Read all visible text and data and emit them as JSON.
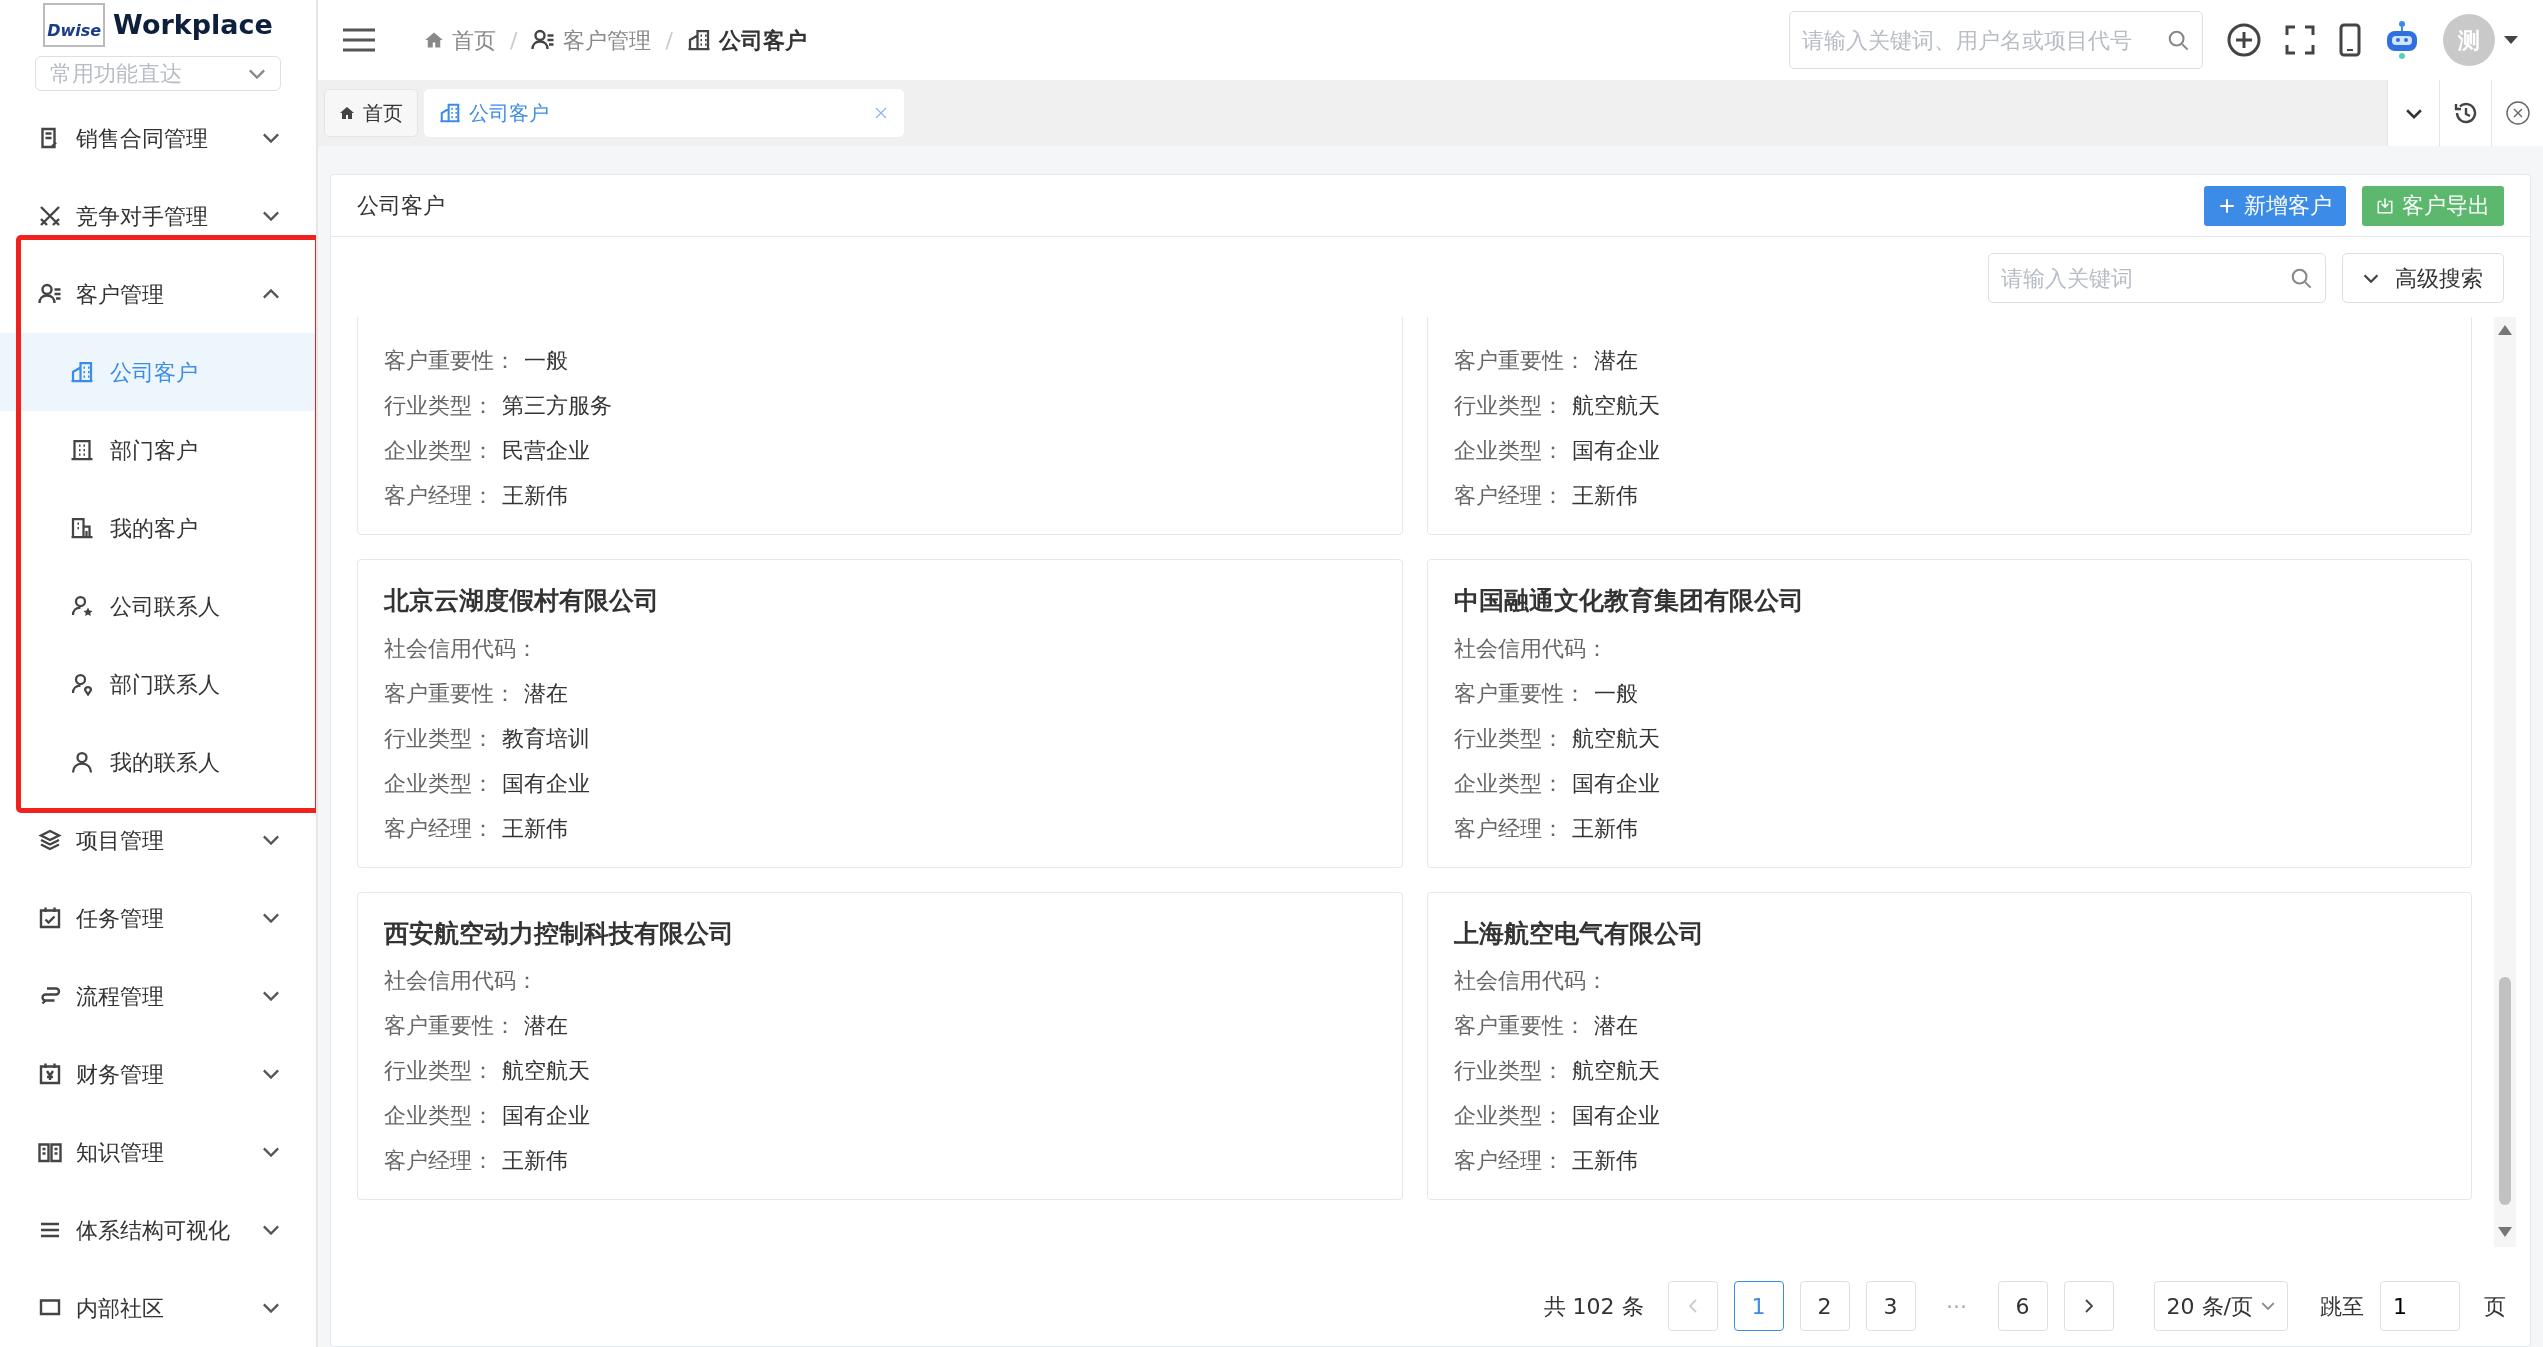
{
  "logo": {
    "mark": "Dwise",
    "title": "Workplace"
  },
  "quick_select": {
    "placeholder": "常用功能直达"
  },
  "sidebar": {
    "items": [
      {
        "label": "销售合同管理",
        "expanded": false,
        "highlighted": false
      },
      {
        "label": "竞争对手管理",
        "expanded": false,
        "highlighted": false
      },
      {
        "label": "客户管理",
        "expanded": true,
        "highlighted": true,
        "children": [
          {
            "label": "公司客户",
            "selected": true
          },
          {
            "label": "部门客户",
            "selected": false
          },
          {
            "label": "我的客户",
            "selected": false
          },
          {
            "label": "公司联系人",
            "selected": false
          },
          {
            "label": "部门联系人",
            "selected": false
          },
          {
            "label": "我的联系人",
            "selected": false
          }
        ]
      },
      {
        "label": "项目管理",
        "expanded": false,
        "highlighted": false
      },
      {
        "label": "任务管理",
        "expanded": false,
        "highlighted": false
      },
      {
        "label": "流程管理",
        "expanded": false,
        "highlighted": false
      },
      {
        "label": "财务管理",
        "expanded": false,
        "highlighted": false
      },
      {
        "label": "知识管理",
        "expanded": false,
        "highlighted": false
      },
      {
        "label": "体系结构可视化",
        "expanded": false,
        "highlighted": false
      },
      {
        "label": "内部社区",
        "expanded": false,
        "highlighted": false
      }
    ]
  },
  "breadcrumbs": [
    {
      "label": "首页"
    },
    {
      "separator": "/",
      "label": "客户管理"
    },
    {
      "separator": "/",
      "label": "公司客户"
    }
  ],
  "header_search": {
    "placeholder": "请输入关键词、用户名或项目代号"
  },
  "avatar": {
    "text": "测"
  },
  "tabs": [
    {
      "label": "首页",
      "selected": false
    },
    {
      "label": "公司客户",
      "selected": true
    }
  ],
  "panel": {
    "title": "公司客户",
    "buttons": [
      {
        "label": "新增客户",
        "kind": "primary"
      },
      {
        "label": "客户导出",
        "kind": "success"
      }
    ],
    "search": {
      "placeholder": "请输入关键词"
    },
    "advanced": "高级搜索"
  },
  "cards": [
    {
      "fields": [
        {
          "label": "客户重要性：",
          "value": "一般"
        },
        {
          "label": "行业类型：",
          "value": "第三方服务"
        },
        {
          "label": "企业类型：",
          "value": "民营企业"
        },
        {
          "label": "客户经理：",
          "value": "王新伟"
        }
      ]
    },
    {
      "fields": [
        {
          "label": "客户重要性：",
          "value": "潜在"
        },
        {
          "label": "行业类型：",
          "value": "航空航天"
        },
        {
          "label": "企业类型：",
          "value": "国有企业"
        },
        {
          "label": "客户经理：",
          "value": "王新伟"
        }
      ]
    },
    {
      "title": "北京云湖度假村有限公司",
      "fields": [
        {
          "label": "社会信用代码："
        },
        {
          "label": "客户重要性：",
          "value": "潜在"
        },
        {
          "label": "行业类型：",
          "value": "教育培训"
        },
        {
          "label": "企业类型：",
          "value": "国有企业"
        },
        {
          "label": "客户经理：",
          "value": "王新伟"
        }
      ]
    },
    {
      "title": "中国融通文化教育集团有限公司",
      "fields": [
        {
          "label": "社会信用代码："
        },
        {
          "label": "客户重要性：",
          "value": "一般"
        },
        {
          "label": "行业类型：",
          "value": "航空航天"
        },
        {
          "label": "企业类型：",
          "value": "国有企业"
        },
        {
          "label": "客户经理：",
          "value": "王新伟"
        }
      ]
    },
    {
      "title": "西安航空动力控制科技有限公司",
      "fields": [
        {
          "label": "社会信用代码："
        },
        {
          "label": "客户重要性：",
          "value": "潜在"
        },
        {
          "label": "行业类型：",
          "value": "航空航天"
        },
        {
          "label": "企业类型：",
          "value": "国有企业"
        },
        {
          "label": "客户经理：",
          "value": "王新伟"
        }
      ]
    },
    {
      "title": "上海航空电气有限公司",
      "fields": [
        {
          "label": "社会信用代码："
        },
        {
          "label": "客户重要性：",
          "value": "潜在"
        },
        {
          "label": "行业类型：",
          "value": "航空航天"
        },
        {
          "label": "企业类型：",
          "value": "国有企业"
        },
        {
          "label": "客户经理：",
          "value": "王新伟"
        }
      ]
    }
  ],
  "pagination": {
    "total": "共 102 条",
    "prev_disabled": true,
    "pages": [
      {
        "label": "1",
        "selected": true
      },
      {
        "label": "2",
        "selected": false
      },
      {
        "label": "3",
        "selected": false
      },
      {
        "label": "···",
        "kind": "ellipsis"
      },
      {
        "label": "6",
        "selected": false
      }
    ],
    "page_size": "20 条/页",
    "jump_label": "跳至",
    "jump_value": "1",
    "page_unit": "页"
  }
}
